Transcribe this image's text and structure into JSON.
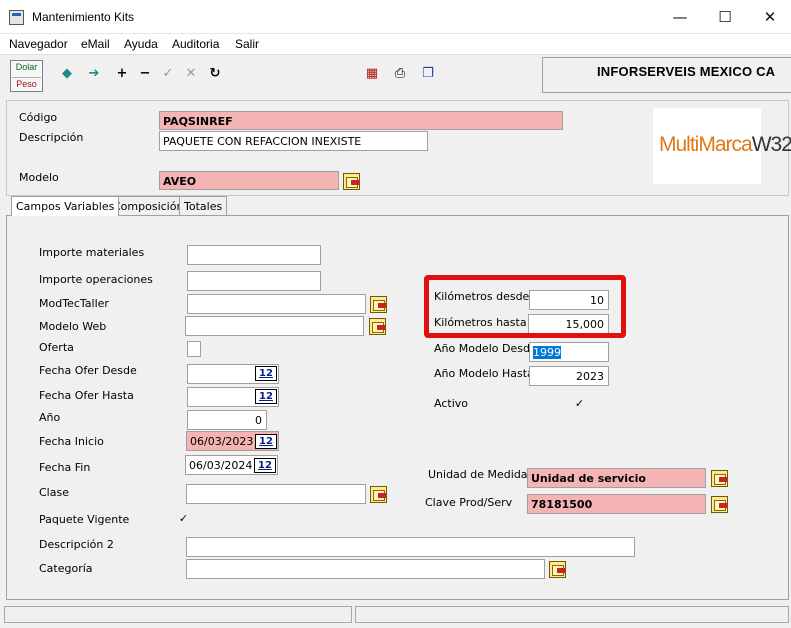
{
  "window": {
    "title": "Mantenimiento Kits",
    "minimize": "—",
    "maximize": "☐",
    "close": "✕"
  },
  "menu": [
    "Navegador",
    "eMail",
    "Ayuda",
    "Auditoria",
    "Salir"
  ],
  "toolbar": {
    "currency_top": "Dolar",
    "currency_bottom": "Peso",
    "company": "INFORSERVEIS MEXICO CA",
    "icons": [
      "arrow-left-icon",
      "arrow-right-icon",
      "plus-icon",
      "minus-icon",
      "check-icon",
      "cancel-icon",
      "refresh-icon",
      "export-icon",
      "print-icon",
      "copy-icon"
    ]
  },
  "header": {
    "codigo_label": "Código",
    "codigo_value": "PAQSINREF",
    "descripcion_label": "Descripción",
    "descripcion_value": "PAQUETE CON REFACCION INEXISTE",
    "modelo_label": "Modelo",
    "modelo_value": "AVEO",
    "logo_main": "MultiMarca",
    "logo_suffix": "W32"
  },
  "tabs": [
    "Campos Variables",
    "Composición",
    "Totales"
  ],
  "left_fields": {
    "importe_materiales": {
      "label": "Importe materiales",
      "value": ""
    },
    "importe_operaciones": {
      "label": "Importe operaciones",
      "value": ""
    },
    "modtec_taller": {
      "label": "ModTecTaller",
      "value": ""
    },
    "modelo_web": {
      "label": "Modelo Web",
      "value": ""
    },
    "oferta": {
      "label": "Oferta",
      "value": ""
    },
    "fecha_ofer_desde": {
      "label": "Fecha Ofer Desde",
      "value": ""
    },
    "fecha_ofer_hasta": {
      "label": "Fecha Ofer Hasta",
      "value": ""
    },
    "anio": {
      "label": "Año",
      "value": "0"
    },
    "fecha_inicio": {
      "label": "Fecha Inicio",
      "value": "06/03/2023"
    },
    "fecha_fin": {
      "label": "Fecha Fin",
      "value": "06/03/2024"
    },
    "clase": {
      "label": "Clase",
      "value": ""
    },
    "paquete_vigente": {
      "label": "Paquete Vigente",
      "checked": "✓"
    },
    "descripcion2": {
      "label": "Descripción 2",
      "value": ""
    },
    "categoria": {
      "label": "Categoría",
      "value": ""
    },
    "calendar_label": "12"
  },
  "right_fields": {
    "km_desde": {
      "label": "Kilómetros desde",
      "value": "10"
    },
    "km_hasta": {
      "label": "Kilómetros hasta",
      "value": "15,000"
    },
    "anio_desde": {
      "label": "Año Modelo Desde",
      "value": "1999"
    },
    "anio_hasta": {
      "label": "Año Modelo Hasta",
      "value": "2023"
    },
    "activo": {
      "label": "Activo",
      "checked": "✓"
    },
    "unidad_medida": {
      "label": "Unidad de Medida",
      "value": "Unidad de servicio"
    },
    "clave_prod": {
      "label": "Clave Prod/Serv",
      "value": "78181500"
    }
  },
  "colors": {
    "required_field": "#f5b4b4",
    "highlight": "#e01010",
    "selection": "#0078d7"
  }
}
